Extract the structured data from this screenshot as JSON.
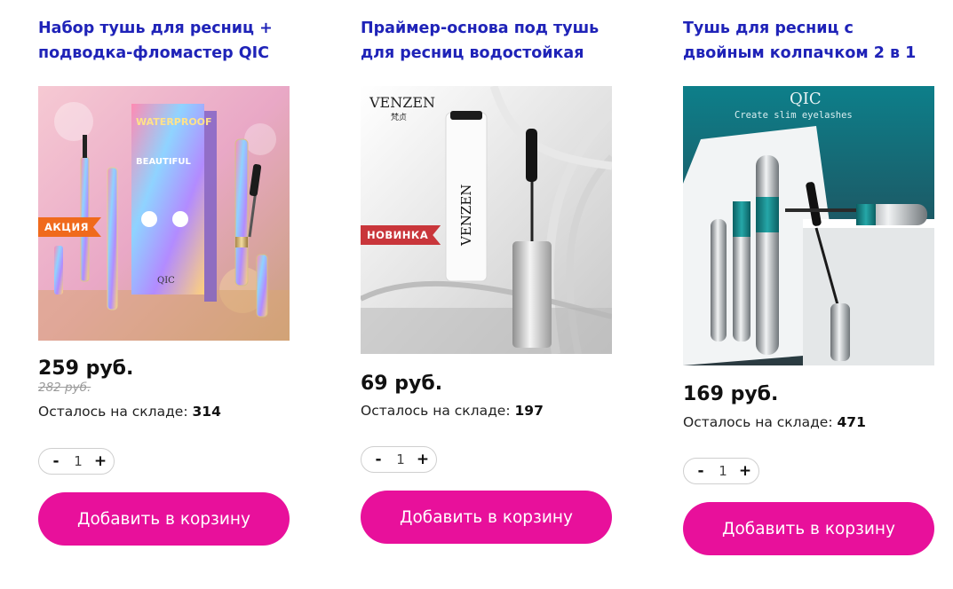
{
  "products": [
    {
      "title": "Набор тушь для ресниц +\nподводка-фломастер QIC",
      "badge": "АКЦИЯ",
      "image_brand": "QIC",
      "image_box_text": "WATERPROOF",
      "image_box_sub": "BEAUTIFUL",
      "price": "259 руб.",
      "old_price": "282 руб.",
      "stock_label": "Осталось на складе:",
      "stock_value": "314",
      "qty": "1",
      "qty_minus": "-",
      "qty_plus": "+",
      "cart_label": "Добавить в корзину"
    },
    {
      "title": "Праймер-основа под тушь\nдля ресниц водостойкая",
      "badge": "НОВИНКА",
      "image_brand": "VENZEN",
      "image_brand_sub": "梵贞",
      "image_tube_text": "VENZEN",
      "price": "69 руб.",
      "stock_label": "Осталось на складе:",
      "stock_value": "197",
      "qty": "1",
      "qty_minus": "-",
      "qty_plus": "+",
      "cart_label": "Добавить в корзину"
    },
    {
      "title": "Тушь для ресниц с\nдвойным колпачком 2 в 1",
      "image_brand": "QIC",
      "image_tagline": "Create slim eyelashes",
      "price": "169 руб.",
      "stock_label": "Осталось на складе:",
      "stock_value": "471",
      "qty": "1",
      "qty_minus": "-",
      "qty_plus": "+",
      "cart_label": "Добавить в корзину"
    }
  ],
  "colors": {
    "title": "#1f23b8",
    "cart_button": "#e8109b",
    "badge_sale": "#f06a1c",
    "badge_new": "#c9363b"
  }
}
